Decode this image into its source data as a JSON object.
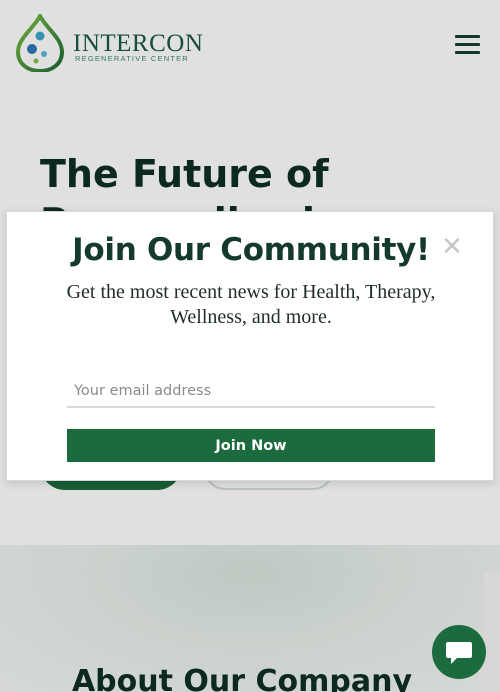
{
  "header": {
    "logo_name": "INTERCON",
    "logo_tagline": "REGENERATIVE CENTER",
    "menu_icon": "hamburger-menu-icon"
  },
  "hero": {
    "title": "The Future of Personalized"
  },
  "about": {
    "title": "About Our Company"
  },
  "modal": {
    "title": "Join Our Community!",
    "description": "Get the most recent news for Health, Therapy, Wellness, and more.",
    "email_placeholder": "Your email address",
    "submit_label": "Join Now",
    "close_icon": "close-icon"
  },
  "chat": {
    "icon": "chat-bubble-icon"
  },
  "colors": {
    "brand_green": "#1c6b3e",
    "heading": "#0d2f24",
    "logo_text": "#1b5a44"
  }
}
